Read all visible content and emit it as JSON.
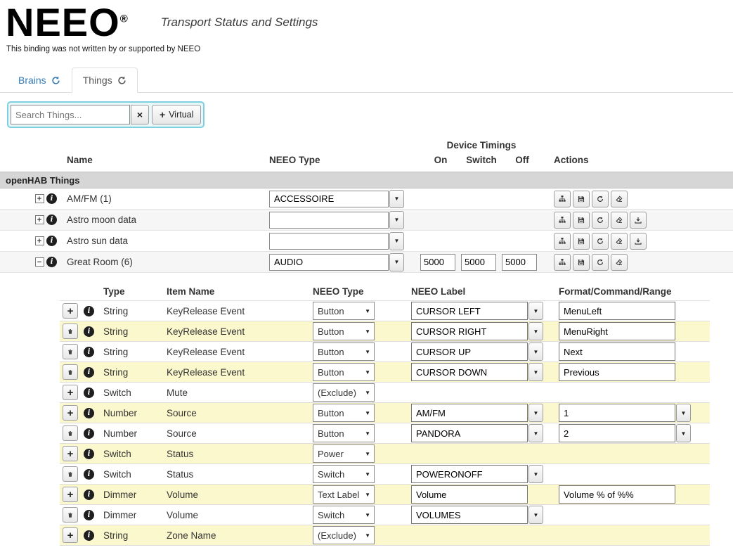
{
  "header": {
    "logo": "NEEO",
    "registered": "®",
    "title": "Transport Status and Settings",
    "disclaimer": "This binding was not written by or supported by NEEO"
  },
  "tabs": {
    "brains": "Brains",
    "things": "Things"
  },
  "toolbar": {
    "search_placeholder": "Search Things...",
    "virtual_label": "Virtual"
  },
  "icons": {
    "caret_down": "▼",
    "clear": "×",
    "plus": "+",
    "expand": "+",
    "collapse": "−",
    "info": "i"
  },
  "things_table": {
    "headers": {
      "name": "Name",
      "neeo_type": "NEEO Type",
      "device_timings": "Device Timings",
      "on": "On",
      "switch": "Switch",
      "off": "Off",
      "actions": "Actions"
    },
    "group_header": "openHAB Things",
    "rows": [
      {
        "name": "AM/FM (1)",
        "neeo_type": "ACCESSOIRE",
        "on": "",
        "switch": "",
        "off": ""
      },
      {
        "name": "Astro moon data",
        "neeo_type": "",
        "on": "",
        "switch": "",
        "off": ""
      },
      {
        "name": "Astro sun data",
        "neeo_type": "",
        "on": "",
        "switch": "",
        "off": ""
      },
      {
        "name": "Great Room (6)",
        "neeo_type": "AUDIO",
        "on": "5000",
        "switch": "5000",
        "off": "5000"
      }
    ]
  },
  "channels_table": {
    "headers": {
      "type": "Type",
      "item_name": "Item Name",
      "neeo_type": "NEEO Type",
      "neeo_label": "NEEO Label",
      "format": "Format/Command/Range"
    },
    "rows": [
      {
        "type": "String",
        "item_name": "KeyRelease Event",
        "neeo_type": "Button",
        "neeo_label": "CURSOR LEFT",
        "format": "MenuLeft"
      },
      {
        "type": "String",
        "item_name": "KeyRelease Event",
        "neeo_type": "Button",
        "neeo_label": "CURSOR RIGHT",
        "format": "MenuRight"
      },
      {
        "type": "String",
        "item_name": "KeyRelease Event",
        "neeo_type": "Button",
        "neeo_label": "CURSOR UP",
        "format": "Next"
      },
      {
        "type": "String",
        "item_name": "KeyRelease Event",
        "neeo_type": "Button",
        "neeo_label": "CURSOR DOWN",
        "format": "Previous"
      },
      {
        "type": "Switch",
        "item_name": "Mute",
        "neeo_type": "(Exclude)",
        "neeo_label": "",
        "format": ""
      },
      {
        "type": "Number",
        "item_name": "Source",
        "neeo_type": "Button",
        "neeo_label": "AM/FM",
        "format": "1"
      },
      {
        "type": "Number",
        "item_name": "Source",
        "neeo_type": "Button",
        "neeo_label": "PANDORA",
        "format": "2"
      },
      {
        "type": "Switch",
        "item_name": "Status",
        "neeo_type": "Power",
        "neeo_label": "",
        "format": ""
      },
      {
        "type": "Switch",
        "item_name": "Status",
        "neeo_type": "Switch",
        "neeo_label": "POWERONOFF",
        "format": ""
      },
      {
        "type": "Dimmer",
        "item_name": "Volume",
        "neeo_type": "Text Label",
        "neeo_label": "Volume",
        "format": "Volume % of %%"
      },
      {
        "type": "Dimmer",
        "item_name": "Volume",
        "neeo_type": "Switch",
        "neeo_label": "VOLUMES",
        "format": ""
      },
      {
        "type": "String",
        "item_name": "Zone Name",
        "neeo_type": "(Exclude)",
        "neeo_label": "",
        "format": ""
      }
    ]
  }
}
